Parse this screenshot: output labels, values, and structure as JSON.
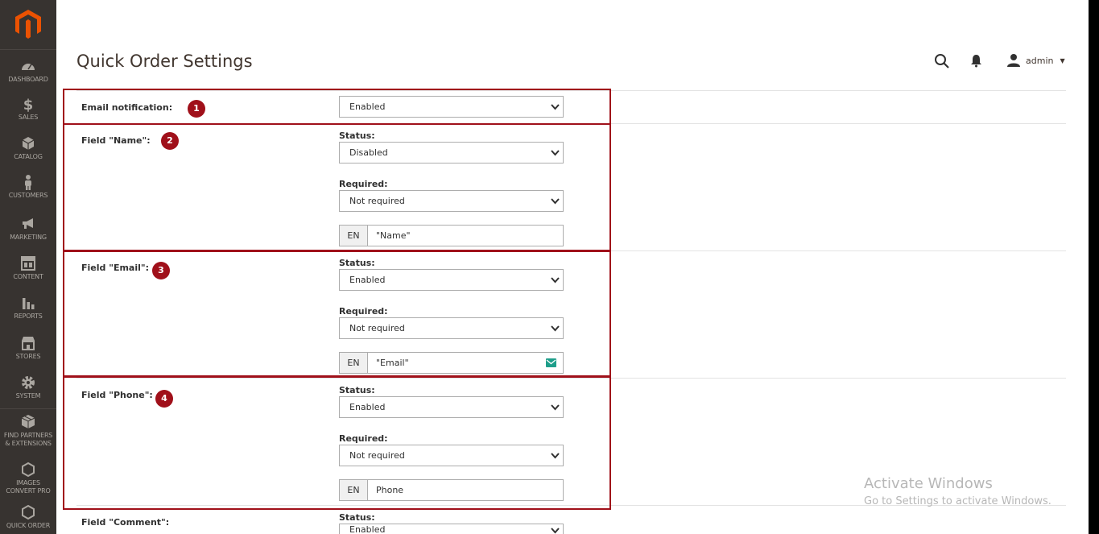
{
  "sidebar": {
    "items": [
      {
        "label": "DASHBOARD",
        "icon": "dashboard-icon"
      },
      {
        "label": "SALES",
        "icon": "dollar-icon"
      },
      {
        "label": "CATALOG",
        "icon": "cube-icon"
      },
      {
        "label": "CUSTOMERS",
        "icon": "person-icon"
      },
      {
        "label": "MARKETING",
        "icon": "megaphone-icon"
      },
      {
        "label": "CONTENT",
        "icon": "layout-icon"
      },
      {
        "label": "REPORTS",
        "icon": "bar-chart-icon"
      },
      {
        "label": "STORES",
        "icon": "storefront-icon"
      },
      {
        "label": "SYSTEM",
        "icon": "gear-icon"
      },
      {
        "label1": "FIND PARTNERS",
        "label2": "& EXTENSIONS",
        "icon": "boxes-icon"
      },
      {
        "label1": "IMAGES",
        "label2": "CONVERT PRO",
        "icon": "hexagon-icon"
      },
      {
        "label": "QUICK ORDER",
        "icon": "hexagon-icon"
      }
    ]
  },
  "header": {
    "title": "Quick Order Settings",
    "user": "admin"
  },
  "form": {
    "email_notification": {
      "label": "Email notification:",
      "value": "Enabled",
      "badge": "1"
    },
    "name": {
      "label": "Field \"Name\":",
      "badge": "2",
      "status_label": "Status:",
      "status": "Disabled",
      "required_label": "Required:",
      "required": "Not required",
      "lang": "EN",
      "text": "\"Name\""
    },
    "email": {
      "label": "Field \"Email\":",
      "badge": "3",
      "status_label": "Status:",
      "status": "Enabled",
      "required_label": "Required:",
      "required": "Not required",
      "lang": "EN",
      "text": "\"Email\""
    },
    "phone": {
      "label": "Field \"Phone\":",
      "badge": "4",
      "status_label": "Status:",
      "status": "Enabled",
      "required_label": "Required:",
      "required": "Not required",
      "lang": "EN",
      "text": "Phone"
    },
    "comment": {
      "label": "Field \"Comment\":",
      "status_label": "Status:",
      "status": "Enabled"
    }
  },
  "watermark": {
    "title": "Activate Windows",
    "subtitle": "Go to Settings to activate Windows."
  },
  "colors": {
    "sidebar_bg": "#373330",
    "highlight": "#a0101a",
    "logo": "#eb5202"
  }
}
